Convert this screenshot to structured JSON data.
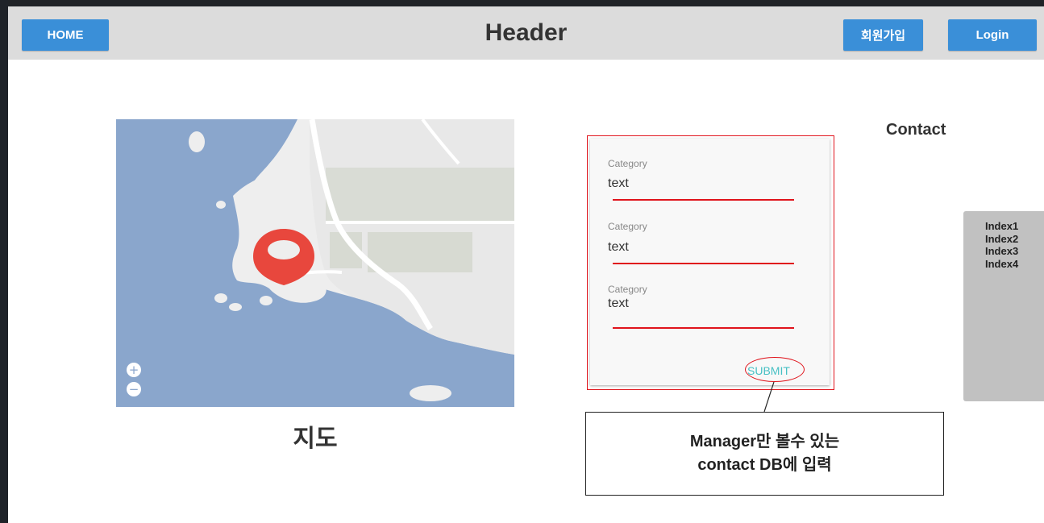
{
  "header": {
    "home_label": "HOME",
    "title": "Header",
    "signup_label": "회원가입",
    "login_label": "Login"
  },
  "map": {
    "caption": "지도",
    "icons": [
      "zoom-in-icon",
      "zoom-out-icon",
      "location-pin-icon"
    ],
    "zoom_in_symbol": "+",
    "zoom_out_symbol": "−"
  },
  "form": {
    "fields": [
      {
        "label": "Category",
        "value": "text"
      },
      {
        "label": "Category",
        "value": "text"
      },
      {
        "label": "Category",
        "value": "text"
      }
    ],
    "submit_label": "SUBMIT"
  },
  "note": {
    "line1": "Manager만 볼수 있는",
    "line2": "contact DB에 입력"
  },
  "contact": {
    "title": "Contact",
    "index_items": [
      "Index1",
      "Index2",
      "Index3",
      "Index4"
    ]
  },
  "colors": {
    "button": "#3a8fd8",
    "header_bg": "#dcdcdc",
    "annotation_red": "#e0141c",
    "submit_teal": "#47c0c4",
    "water": "#8aa6cc",
    "pin": "#e8473d",
    "index_panel": "#c1c1c1"
  }
}
